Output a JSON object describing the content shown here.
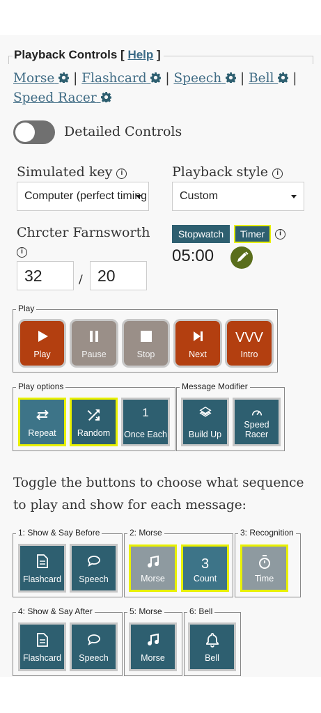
{
  "header": {
    "title": "Playback Controls [ ",
    "help": "Help",
    "close": " ]"
  },
  "links": {
    "morse": "Morse",
    "flashcard": "Flashcard",
    "speech": "Speech",
    "bell": "Bell",
    "speed_racer": "Speed Racer",
    "sep": "|"
  },
  "detailed_controls": {
    "label": "Detailed Controls",
    "enabled": false
  },
  "simulated_key": {
    "label": "Simulated key",
    "value": "Computer (perfect timing"
  },
  "playback_style": {
    "label": "Playback style",
    "value": "Custom"
  },
  "farnsworth": {
    "label": "Chrcter Farnsworth",
    "char_speed": "32",
    "slash": "/",
    "eff_speed": "20"
  },
  "timer": {
    "stopwatch": "Stopwatch",
    "timer": "Timer",
    "value": "05:00"
  },
  "play_group": {
    "label": "Play",
    "buttons": [
      "Play",
      "Pause",
      "Stop",
      "Next",
      "Intro"
    ],
    "intro_glyph": "VVV"
  },
  "play_options": {
    "label": "Play options",
    "repeat": "Repeat",
    "random": "Random",
    "once_num": "1",
    "once_label": "Once Each"
  },
  "message_modifier": {
    "label": "Message Modifier",
    "build_up": "Build Up",
    "speed_racer": "Speed Racer"
  },
  "instructions": "Toggle the buttons to choose what sequence to play and show for each message:",
  "seq1": {
    "label": "1: Show & Say Before",
    "flashcard": "Flashcard",
    "speech": "Speech"
  },
  "seq2": {
    "label": "2: Morse",
    "morse": "Morse",
    "count_num": "3",
    "count": "Count"
  },
  "seq3": {
    "label": "3: Recognition",
    "time": "Time"
  },
  "seq4": {
    "label": "4: Show & Say After",
    "flashcard": "Flashcard",
    "speech": "Speech"
  },
  "seq5": {
    "label": "5: Morse",
    "morse": "Morse"
  },
  "seq6": {
    "label": "6: Bell",
    "bell": "Bell"
  },
  "colors": {
    "teal": "#2e5f70",
    "red": "#b33f10",
    "gray": "#9a8f88",
    "highlight": "#e8f000",
    "link": "#3f6b84"
  }
}
